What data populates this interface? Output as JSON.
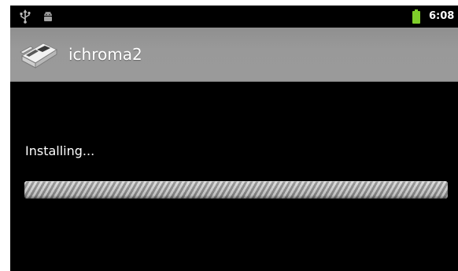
{
  "status_bar": {
    "time": "6:08",
    "icons": [
      "usb-icon",
      "android-debug-icon",
      "battery-icon"
    ],
    "battery_color": "#7fce2a"
  },
  "title_bar": {
    "app_name": "ichroma2",
    "app_icon": "ichroma2-app-icon"
  },
  "content": {
    "status_text": "Installing...",
    "progress_state": "indeterminate"
  }
}
